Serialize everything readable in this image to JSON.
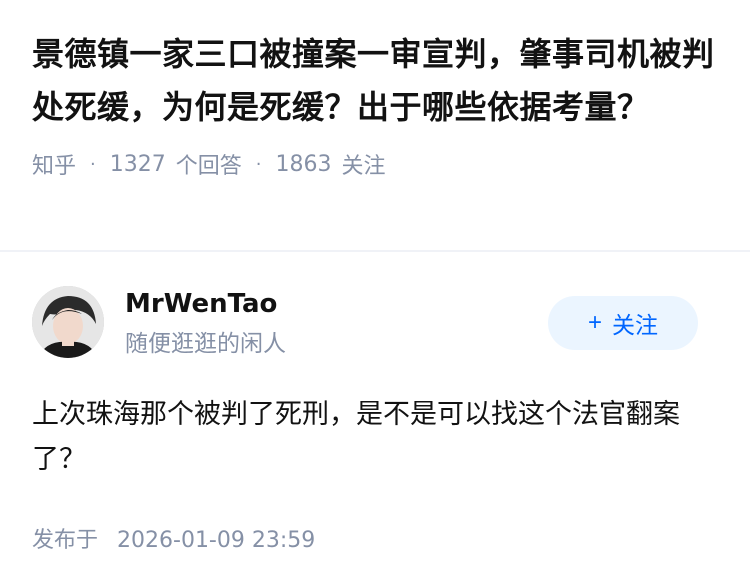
{
  "question": {
    "title": "景德镇一家三口被撞案一审宣判，肇事司机被判处死缓，为何是死缓？出于哪些依据考量？",
    "source": "知乎",
    "answer_count": "1327",
    "answer_label": "个回答",
    "follower_count": "1863",
    "follower_label": "关注"
  },
  "author": {
    "name": "MrWenTao",
    "bio": "随便逛逛的闲人",
    "follow_button": {
      "icon": "+",
      "label": "关注"
    }
  },
  "answer": {
    "content": "上次珠海那个被判了死刑，是不是可以找这个法官翻案了？",
    "published_label": "发布于",
    "published_time": "2026-01-09 23:59"
  },
  "colors": {
    "text_primary": "#121212",
    "text_secondary": "#8590a6",
    "brand_blue": "#0066ff",
    "follow_bg": "#ebf5ff"
  }
}
